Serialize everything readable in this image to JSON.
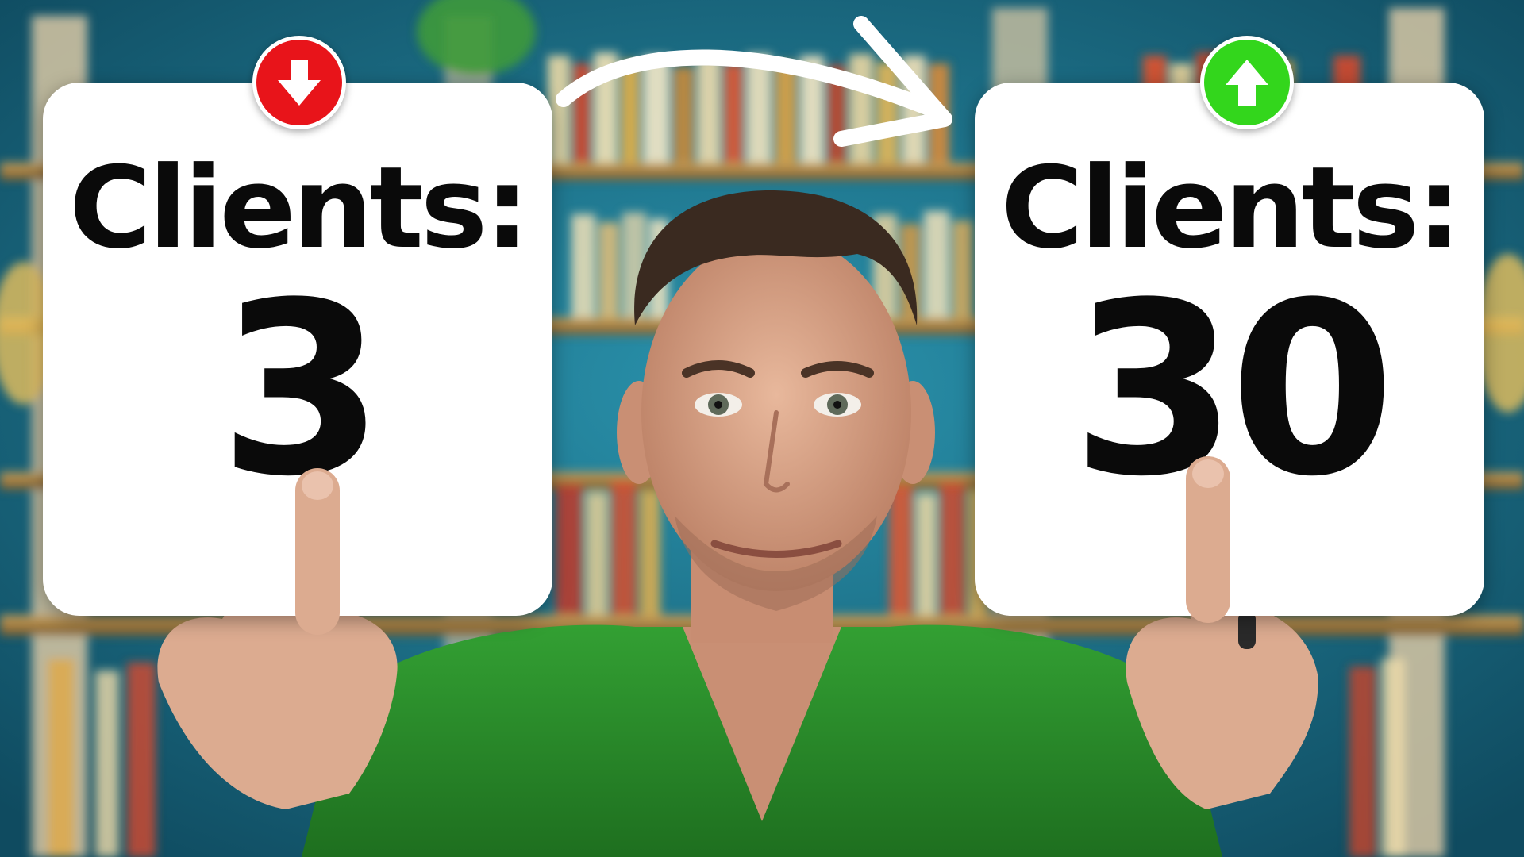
{
  "left_card": {
    "label": "Clients:",
    "value": "3"
  },
  "right_card": {
    "label": "Clients:",
    "value": "30"
  },
  "colors": {
    "background": "#1b6e86",
    "card": "#ffffff",
    "text": "#0a0a0a",
    "decrease_badge": "#e8141a",
    "increase_badge": "#33d61c",
    "shirt": "#2b8a2a",
    "skin": "#d9a58a"
  },
  "icons": {
    "left_badge": "arrow-down-icon",
    "right_badge": "arrow-up-icon",
    "transition": "curved-arrow-icon"
  }
}
